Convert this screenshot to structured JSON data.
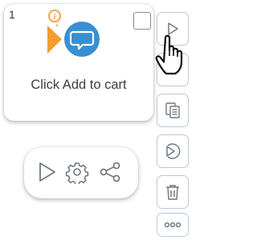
{
  "step": {
    "number": "1",
    "label": "Click Add to cart",
    "info_icon": "info-icon",
    "type_icon": "speech-bubble-icon"
  },
  "action_pill": {
    "buttons": [
      "play-icon",
      "gear-icon",
      "share-icon"
    ]
  },
  "toolbar": {
    "buttons": [
      "play-icon",
      "copy-icon",
      "play-circle-icon",
      "trash-icon",
      "more-icon"
    ]
  },
  "colors": {
    "accent_blue": "#3a8fd1",
    "marker_orange": "#f39c2f",
    "icon_gray": "#6f7a86",
    "toolbar_border": "#b9c9d8"
  }
}
